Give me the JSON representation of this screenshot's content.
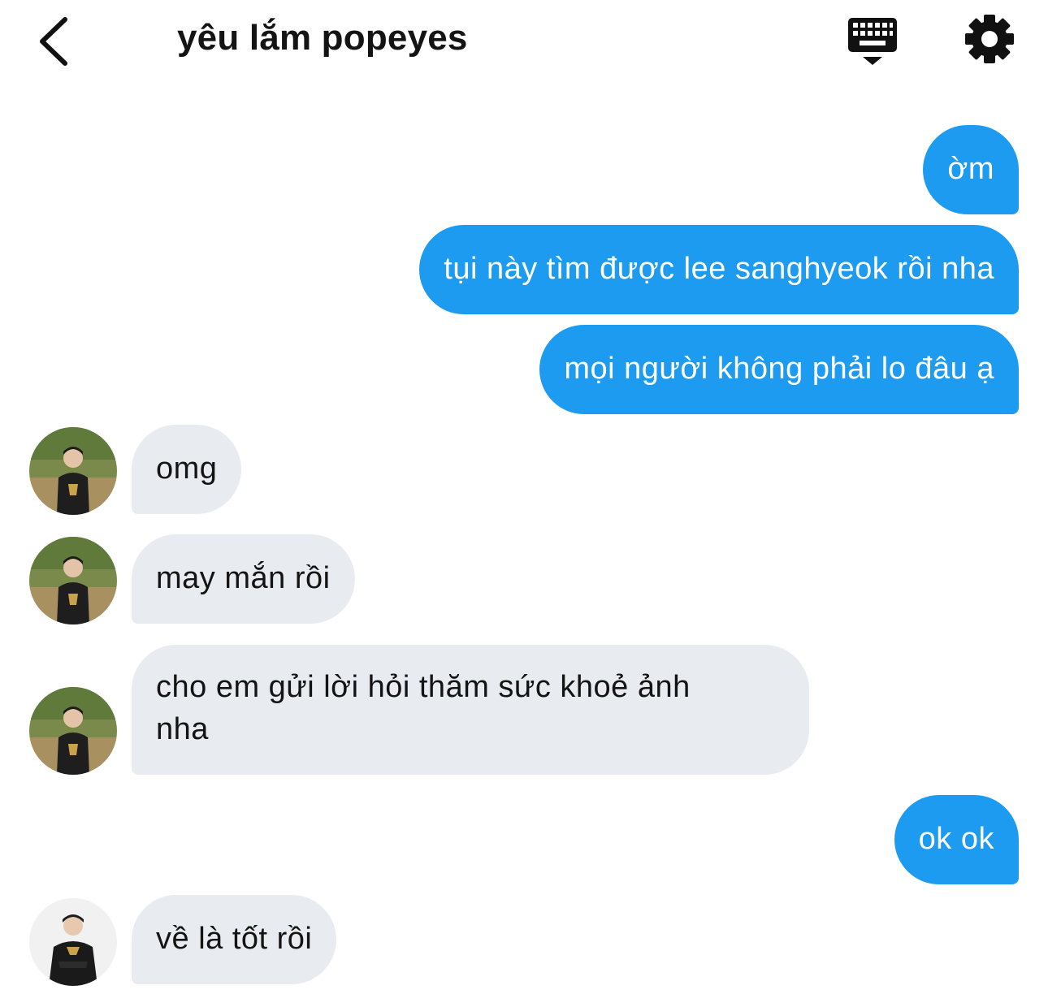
{
  "header": {
    "title": "yêu lắm popeyes",
    "icons": [
      "back-chevron-icon",
      "keyboard-icon",
      "gear-icon"
    ]
  },
  "messages": [
    {
      "side": "out",
      "text": "ờm"
    },
    {
      "side": "out",
      "text": "tụi này tìm được lee sanghyeok rồi nha"
    },
    {
      "side": "out",
      "text": "mọi người không phải lo đâu ạ"
    },
    {
      "side": "in",
      "text": "omg"
    },
    {
      "side": "in",
      "text": "may mắn rồi"
    },
    {
      "side": "in",
      "line1": "cho em gửi lời hỏi thăm sức khoẻ ảnh",
      "line2": "nha"
    },
    {
      "side": "out",
      "text": "ok ok"
    },
    {
      "side": "in",
      "text": "về là tốt rồi"
    }
  ],
  "colors": {
    "outgoing_bubble": "#1d9bf0",
    "incoming_bubble": "#e8ecf0",
    "text_dark": "#141414",
    "text_light": "#ffffff"
  }
}
